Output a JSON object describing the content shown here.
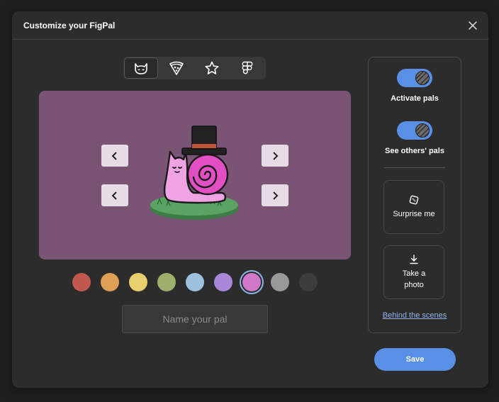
{
  "dialog": {
    "title": "Customize your FigPal"
  },
  "tabs": [
    {
      "icon": "cat-icon",
      "active": true
    },
    {
      "icon": "pizza-icon",
      "active": false
    },
    {
      "icon": "star-icon",
      "active": false
    },
    {
      "icon": "figma-logo-icon",
      "active": false
    }
  ],
  "colors": {
    "preview_bg": "#7a5474",
    "accent": "#5a8fe6",
    "link": "#8fb4e8"
  },
  "swatches": [
    {
      "color": "#c0584f",
      "selected": false
    },
    {
      "color": "#dfa055",
      "selected": false
    },
    {
      "color": "#e6cf6c",
      "selected": false
    },
    {
      "color": "#9fb06d",
      "selected": false
    },
    {
      "color": "#9ec1de",
      "selected": false
    },
    {
      "color": "#a986d6",
      "selected": false
    },
    {
      "color": "#cf78c8",
      "selected": true
    },
    {
      "color": "#999999",
      "selected": false
    },
    {
      "color": "#3d3d3d",
      "selected": false
    }
  ],
  "name_input": {
    "placeholder": "Name your pal",
    "value": ""
  },
  "sidebar": {
    "activate_pals_label": "Activate pals",
    "activate_pals_on": true,
    "see_others_label": "See others' pals",
    "see_others_on": true,
    "surprise_label": "Surprise me",
    "photo_label_line1": "Take a",
    "photo_label_line2": "photo",
    "behind_scenes_label": "Behind the scenes"
  },
  "footer": {
    "save_label": "Save"
  }
}
